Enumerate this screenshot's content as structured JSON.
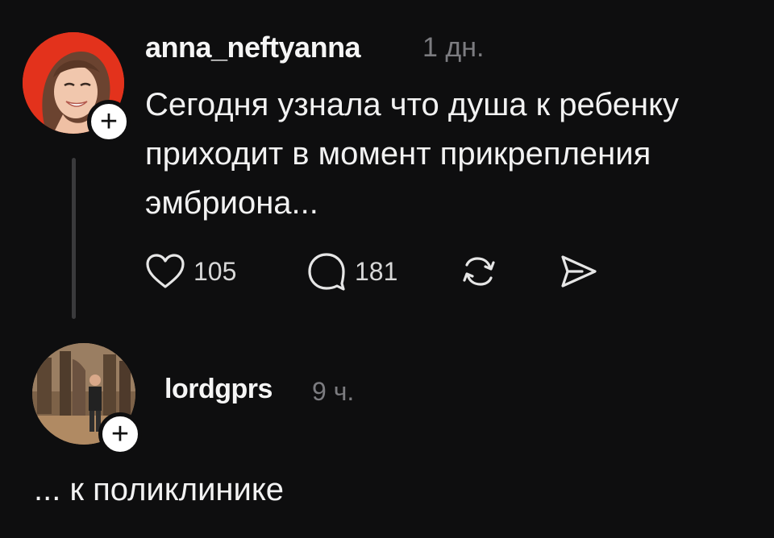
{
  "post": {
    "username": "anna_neftyanna",
    "time": "1 дн.",
    "text_lines": [
      "Сегодня узнала что душа к ребенку",
      "приходит в момент прикрепления",
      "эмбриона..."
    ],
    "likes": "105",
    "replies": "181",
    "avatar_bg": "#e3321c"
  },
  "reply": {
    "username": "lordgprs",
    "time": "9 ч.",
    "text": "... к поликлинике"
  },
  "icons": {
    "like": "heart-icon",
    "reply": "comment-icon",
    "repost": "repost-icon",
    "share": "send-icon",
    "follow": "plus-icon"
  },
  "badge_symbol": "+"
}
